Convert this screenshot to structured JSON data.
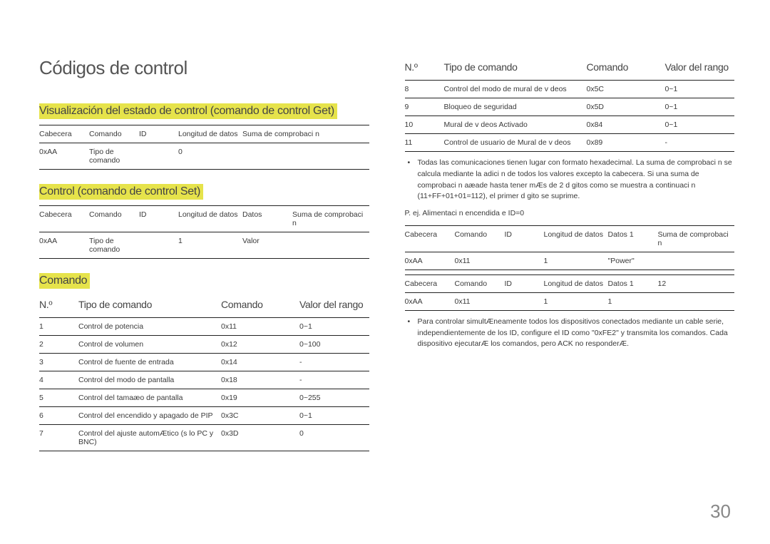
{
  "page_number": "30",
  "title": "Códigos de control",
  "sections": {
    "get": {
      "heading": "Visualización del estado de control (comando de control Get)",
      "headers": {
        "cab": "Cabecera",
        "com": "Comando",
        "id": "ID",
        "ld": "Longitud de datos",
        "sum": "Suma de comprobaci n"
      },
      "row": {
        "cab": "0xAA",
        "com": "Tipo de comando",
        "id": "",
        "ld": "0",
        "sum": ""
      }
    },
    "set": {
      "heading": "Control (comando de control Set)",
      "headers": {
        "cab": "Cabecera",
        "com": "Comando",
        "id": "ID",
        "ld": "Longitud de datos",
        "dat": "Datos",
        "sum": "Suma de comprobaci n"
      },
      "row": {
        "cab": "0xAA",
        "com": "Tipo de comando",
        "id": "",
        "ld": "1",
        "dat": "Valor",
        "sum": ""
      }
    },
    "comando_heading": "Comando",
    "cmd_headers": {
      "no": "N.º",
      "tipo": "Tipo de comando",
      "cmd": "Comando",
      "rng": "Valor del rango"
    },
    "cmd_left": [
      {
        "no": "1",
        "tipo": "Control de potencia",
        "cmd": "0x11",
        "rng": "0~1"
      },
      {
        "no": "2",
        "tipo": "Control de volumen",
        "cmd": "0x12",
        "rng": "0~100"
      },
      {
        "no": "3",
        "tipo": "Control de fuente de entrada",
        "cmd": "0x14",
        "rng": "-"
      },
      {
        "no": "4",
        "tipo": "Control del modo de pantalla",
        "cmd": "0x18",
        "rng": "-"
      },
      {
        "no": "5",
        "tipo": "Control del tamaæo de pantalla",
        "cmd": "0x19",
        "rng": "0~255"
      },
      {
        "no": "6",
        "tipo": "Control del encendido y apagado de PIP",
        "cmd": "0x3C",
        "rng": "0~1"
      },
      {
        "no": "7",
        "tipo": "Control del ajuste automÆtico (s lo PC y BNC)",
        "cmd": "0x3D",
        "rng": "0"
      }
    ],
    "cmd_right": [
      {
        "no": "8",
        "tipo": "Control del modo de mural de v deos",
        "cmd": "0x5C",
        "rng": "0~1"
      },
      {
        "no": "9",
        "tipo": "Bloqueo de seguridad",
        "cmd": "0x5D",
        "rng": "0~1"
      },
      {
        "no": "10",
        "tipo": "Mural de v deos Activado",
        "cmd": "0x84",
        "rng": "0~1"
      },
      {
        "no": "11",
        "tipo": "Control de usuario de Mural de v deos",
        "cmd": "0x89",
        "rng": "-"
      }
    ],
    "note1": "Todas las comunicaciones tienen lugar con formato hexadecimal. La suma de comprobaci n se calcula mediante la adici n de todos los valores excepto la cabecera. Si una suma de comprobaci n aæade hasta tener mÆs de 2 d gitos como se muestra a continuaci n (11+FF+01+01=112), el primer d gito se suprime.",
    "example_label": "P. ej. Alimentaci n encendida e ID=0",
    "ex1": {
      "headers": {
        "cab": "Cabecera",
        "com": "Comando",
        "id": "ID",
        "ld": "Longitud de datos",
        "dat": "Datos 1",
        "sum": "Suma de comprobaci n"
      },
      "row": {
        "cab": "0xAA",
        "com": "0x11",
        "id": "",
        "ld": "1",
        "dat": "\"Power\"",
        "sum": ""
      }
    },
    "ex2": {
      "headers": {
        "cab": "Cabecera",
        "com": "Comando",
        "id": "ID",
        "ld": "Longitud de datos",
        "dat": "Datos 1",
        "sum": "12"
      },
      "row": {
        "cab": "0xAA",
        "com": "0x11",
        "id": "",
        "ld": "1",
        "dat": "1",
        "sum": ""
      }
    },
    "note2": "Para controlar simultÆneamente todos los dispositivos conectados mediante un cable serie, independientemente de los ID, configure el ID como \"0xFE2\" y transmita los comandos. Cada dispositivo ejecutarÆ los comandos, pero ACK no responderÆ."
  }
}
